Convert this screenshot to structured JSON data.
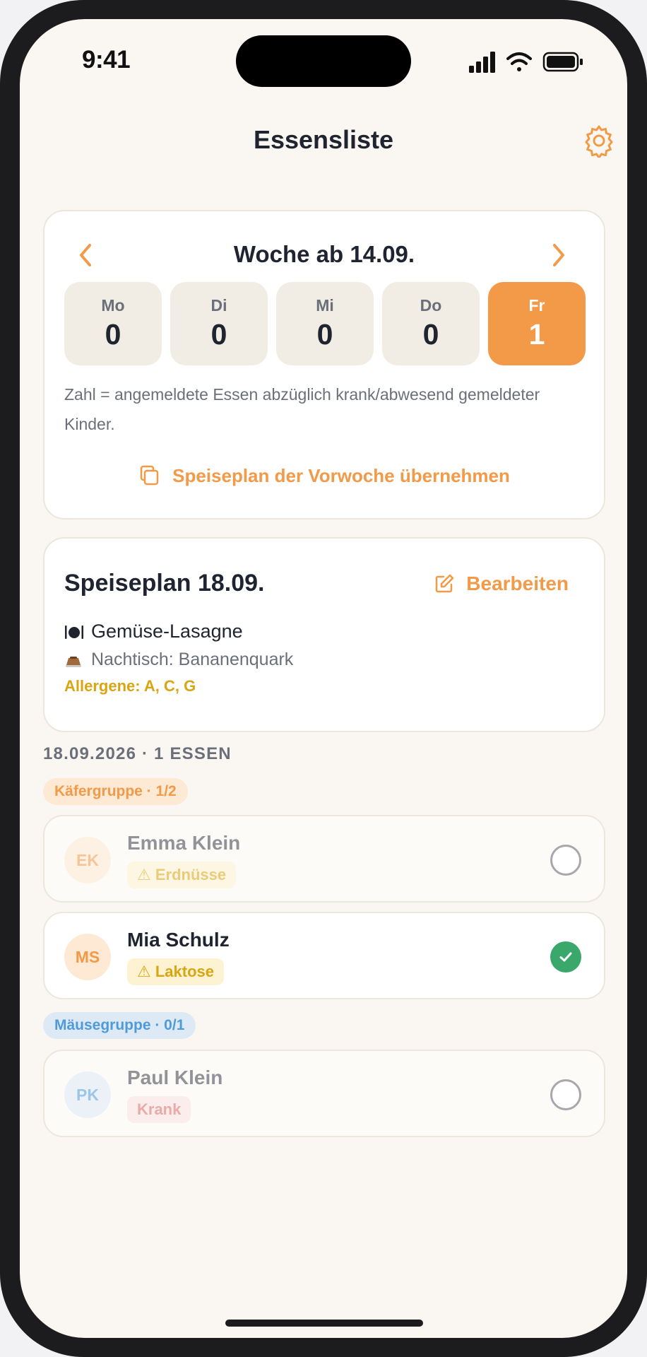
{
  "status_bar": {
    "time": "9:41"
  },
  "header": {
    "title": "Essensliste"
  },
  "week": {
    "title": "Woche ab 14.09.",
    "days": [
      {
        "name": "Mo",
        "count": "0",
        "active": false
      },
      {
        "name": "Di",
        "count": "0",
        "active": false
      },
      {
        "name": "Mi",
        "count": "0",
        "active": false
      },
      {
        "name": "Do",
        "count": "0",
        "active": false
      },
      {
        "name": "Fr",
        "count": "1",
        "active": true
      }
    ],
    "hint": "Zahl = angemeldete Essen abzüglich krank/abwesend gemeldeter Kinder.",
    "copy_label": "Speiseplan der Vorwoche übernehmen"
  },
  "menu_plan": {
    "title": "Speiseplan 18.09.",
    "edit_label": "Bearbeiten",
    "main_dish": "Gemüse-Lasagne",
    "dessert": "Nachtisch: Bananenquark",
    "allergens": "Allergene: A, C, G"
  },
  "section": {
    "date_summary": "18.09.2026 · 1 ESSEN"
  },
  "groups": [
    {
      "label": "Käfergruppe · 1/2",
      "children": [
        {
          "initials": "EK",
          "name": "Emma Klein",
          "tag": "⚠ Erdnüsse",
          "checked": false
        },
        {
          "initials": "MS",
          "name": "Mia Schulz",
          "tag": "⚠ Laktose",
          "checked": true
        }
      ]
    },
    {
      "label": "Mäusegruppe · 0/1",
      "children": [
        {
          "initials": "PK",
          "name": "Paul Klein",
          "tag": "Krank",
          "checked": false
        }
      ]
    }
  ],
  "colors": {
    "accent": "#f29a48",
    "background": "#faf7f2",
    "success": "#3aa86a",
    "warning": "#d9a512",
    "danger": "#d86a6a",
    "info": "#4f9bd8"
  }
}
